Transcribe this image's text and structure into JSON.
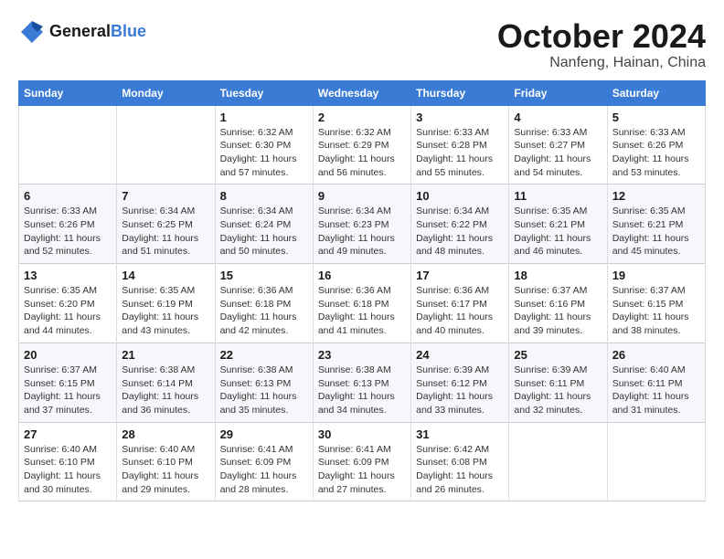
{
  "logo": {
    "line1": "General",
    "line2": "Blue"
  },
  "title": "October 2024",
  "location": "Nanfeng, Hainan, China",
  "days_of_week": [
    "Sunday",
    "Monday",
    "Tuesday",
    "Wednesday",
    "Thursday",
    "Friday",
    "Saturday"
  ],
  "weeks": [
    [
      {
        "num": "",
        "info": ""
      },
      {
        "num": "",
        "info": ""
      },
      {
        "num": "1",
        "info": "Sunrise: 6:32 AM\nSunset: 6:30 PM\nDaylight: 11 hours and 57 minutes."
      },
      {
        "num": "2",
        "info": "Sunrise: 6:32 AM\nSunset: 6:29 PM\nDaylight: 11 hours and 56 minutes."
      },
      {
        "num": "3",
        "info": "Sunrise: 6:33 AM\nSunset: 6:28 PM\nDaylight: 11 hours and 55 minutes."
      },
      {
        "num": "4",
        "info": "Sunrise: 6:33 AM\nSunset: 6:27 PM\nDaylight: 11 hours and 54 minutes."
      },
      {
        "num": "5",
        "info": "Sunrise: 6:33 AM\nSunset: 6:26 PM\nDaylight: 11 hours and 53 minutes."
      }
    ],
    [
      {
        "num": "6",
        "info": "Sunrise: 6:33 AM\nSunset: 6:26 PM\nDaylight: 11 hours and 52 minutes."
      },
      {
        "num": "7",
        "info": "Sunrise: 6:34 AM\nSunset: 6:25 PM\nDaylight: 11 hours and 51 minutes."
      },
      {
        "num": "8",
        "info": "Sunrise: 6:34 AM\nSunset: 6:24 PM\nDaylight: 11 hours and 50 minutes."
      },
      {
        "num": "9",
        "info": "Sunrise: 6:34 AM\nSunset: 6:23 PM\nDaylight: 11 hours and 49 minutes."
      },
      {
        "num": "10",
        "info": "Sunrise: 6:34 AM\nSunset: 6:22 PM\nDaylight: 11 hours and 48 minutes."
      },
      {
        "num": "11",
        "info": "Sunrise: 6:35 AM\nSunset: 6:21 PM\nDaylight: 11 hours and 46 minutes."
      },
      {
        "num": "12",
        "info": "Sunrise: 6:35 AM\nSunset: 6:21 PM\nDaylight: 11 hours and 45 minutes."
      }
    ],
    [
      {
        "num": "13",
        "info": "Sunrise: 6:35 AM\nSunset: 6:20 PM\nDaylight: 11 hours and 44 minutes."
      },
      {
        "num": "14",
        "info": "Sunrise: 6:35 AM\nSunset: 6:19 PM\nDaylight: 11 hours and 43 minutes."
      },
      {
        "num": "15",
        "info": "Sunrise: 6:36 AM\nSunset: 6:18 PM\nDaylight: 11 hours and 42 minutes."
      },
      {
        "num": "16",
        "info": "Sunrise: 6:36 AM\nSunset: 6:18 PM\nDaylight: 11 hours and 41 minutes."
      },
      {
        "num": "17",
        "info": "Sunrise: 6:36 AM\nSunset: 6:17 PM\nDaylight: 11 hours and 40 minutes."
      },
      {
        "num": "18",
        "info": "Sunrise: 6:37 AM\nSunset: 6:16 PM\nDaylight: 11 hours and 39 minutes."
      },
      {
        "num": "19",
        "info": "Sunrise: 6:37 AM\nSunset: 6:15 PM\nDaylight: 11 hours and 38 minutes."
      }
    ],
    [
      {
        "num": "20",
        "info": "Sunrise: 6:37 AM\nSunset: 6:15 PM\nDaylight: 11 hours and 37 minutes."
      },
      {
        "num": "21",
        "info": "Sunrise: 6:38 AM\nSunset: 6:14 PM\nDaylight: 11 hours and 36 minutes."
      },
      {
        "num": "22",
        "info": "Sunrise: 6:38 AM\nSunset: 6:13 PM\nDaylight: 11 hours and 35 minutes."
      },
      {
        "num": "23",
        "info": "Sunrise: 6:38 AM\nSunset: 6:13 PM\nDaylight: 11 hours and 34 minutes."
      },
      {
        "num": "24",
        "info": "Sunrise: 6:39 AM\nSunset: 6:12 PM\nDaylight: 11 hours and 33 minutes."
      },
      {
        "num": "25",
        "info": "Sunrise: 6:39 AM\nSunset: 6:11 PM\nDaylight: 11 hours and 32 minutes."
      },
      {
        "num": "26",
        "info": "Sunrise: 6:40 AM\nSunset: 6:11 PM\nDaylight: 11 hours and 31 minutes."
      }
    ],
    [
      {
        "num": "27",
        "info": "Sunrise: 6:40 AM\nSunset: 6:10 PM\nDaylight: 11 hours and 30 minutes."
      },
      {
        "num": "28",
        "info": "Sunrise: 6:40 AM\nSunset: 6:10 PM\nDaylight: 11 hours and 29 minutes."
      },
      {
        "num": "29",
        "info": "Sunrise: 6:41 AM\nSunset: 6:09 PM\nDaylight: 11 hours and 28 minutes."
      },
      {
        "num": "30",
        "info": "Sunrise: 6:41 AM\nSunset: 6:09 PM\nDaylight: 11 hours and 27 minutes."
      },
      {
        "num": "31",
        "info": "Sunrise: 6:42 AM\nSunset: 6:08 PM\nDaylight: 11 hours and 26 minutes."
      },
      {
        "num": "",
        "info": ""
      },
      {
        "num": "",
        "info": ""
      }
    ]
  ]
}
